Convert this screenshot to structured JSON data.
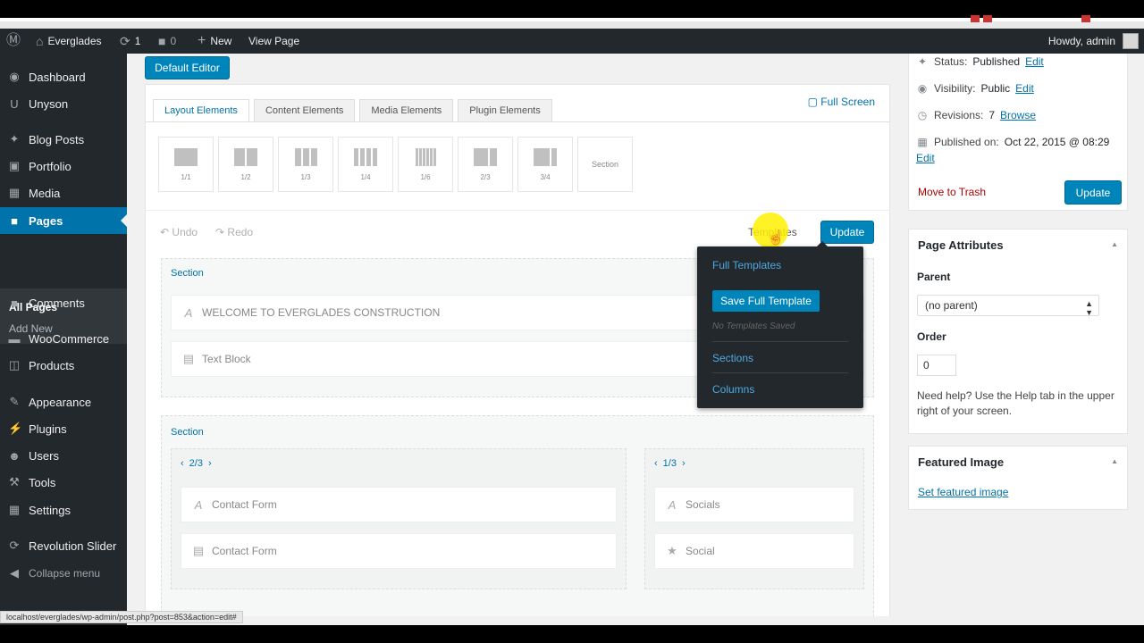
{
  "admin_bar": {
    "site_name": "Everglades",
    "updates_count": "1",
    "comments_count": "0",
    "new_label": "New",
    "view_page_label": "View Page",
    "greeting": "Howdy, admin"
  },
  "sidebar": {
    "items": [
      {
        "label": "Dashboard",
        "icon": "dashboard-icon"
      },
      {
        "label": "Unyson",
        "icon": "unyson-icon"
      },
      {
        "label": "Blog Posts",
        "icon": "pin-icon"
      },
      {
        "label": "Portfolio",
        "icon": "portfolio-icon"
      },
      {
        "label": "Media",
        "icon": "media-icon"
      },
      {
        "label": "Pages",
        "icon": "pages-icon"
      },
      {
        "label": "Comments",
        "icon": "comments-icon"
      },
      {
        "label": "WooCommerce",
        "icon": "woocommerce-icon"
      },
      {
        "label": "Products",
        "icon": "products-icon"
      },
      {
        "label": "Appearance",
        "icon": "appearance-icon"
      },
      {
        "label": "Plugins",
        "icon": "plugins-icon"
      },
      {
        "label": "Users",
        "icon": "users-icon"
      },
      {
        "label": "Tools",
        "icon": "tools-icon"
      },
      {
        "label": "Settings",
        "icon": "settings-icon"
      },
      {
        "label": "Revolution Slider",
        "icon": "slider-icon"
      }
    ],
    "submenu": {
      "all_pages": "All Pages",
      "add_new": "Add New"
    },
    "collapse_label": "Collapse menu",
    "active_color": "#0073aa"
  },
  "editor": {
    "default_editor_label": "Default Editor",
    "tabs": [
      "Layout Elements",
      "Content Elements",
      "Media Elements",
      "Plugin Elements"
    ],
    "full_screen_label": "Full Screen",
    "palette": [
      {
        "label": "1/1"
      },
      {
        "label": "1/2"
      },
      {
        "label": "1/3"
      },
      {
        "label": "1/4"
      },
      {
        "label": "1/6"
      },
      {
        "label": "2/3"
      },
      {
        "label": "3/4"
      },
      {
        "label": "Section"
      }
    ],
    "undo_label": "Undo",
    "redo_label": "Redo",
    "templates_label": "Templates",
    "update_label": "Update",
    "sections": [
      {
        "title": "Section",
        "elements": [
          {
            "label": "WELCOME TO EVERGLADES CONSTRUCTION",
            "icon": "text-icon"
          },
          {
            "label": "Text Block",
            "icon": "textblock-icon"
          }
        ]
      },
      {
        "title": "Section",
        "columns": [
          {
            "width": "2/3",
            "elements": [
              {
                "label": "Contact Form",
                "icon": "text-icon"
              },
              {
                "label": "Contact Form",
                "icon": "form-icon"
              }
            ]
          },
          {
            "width": "1/3",
            "elements": [
              {
                "label": "Socials",
                "icon": "text-icon"
              },
              {
                "label": "Social",
                "icon": "star-icon"
              }
            ]
          }
        ]
      }
    ]
  },
  "templates_dropdown": {
    "full_templates_label": "Full Templates",
    "save_button_label": "Save Full Template",
    "empty_message": "No Templates Saved",
    "sections_label": "Sections",
    "columns_label": "Columns"
  },
  "publish_box": {
    "status_label": "Status:",
    "status_value": "Published",
    "visibility_label": "Visibility:",
    "visibility_value": "Public",
    "revisions_label": "Revisions:",
    "revisions_value": "7",
    "published_on_label": "Published on:",
    "published_on_value": "Oct 22, 2015 @ 08:29",
    "edit_label": "Edit",
    "browse_label": "Browse",
    "trash_label": "Move to Trash",
    "update_label": "Update"
  },
  "page_attributes": {
    "title": "Page Attributes",
    "parent_label": "Parent",
    "parent_value": "(no parent)",
    "order_label": "Order",
    "order_value": "0",
    "help_text": "Need help? Use the Help tab in the upper right of your screen."
  },
  "featured_image": {
    "title": "Featured Image",
    "link_label": "Set featured image"
  },
  "status_bar_url": "localhost/everglades/wp-admin/post.php?post=853&action=edit#"
}
